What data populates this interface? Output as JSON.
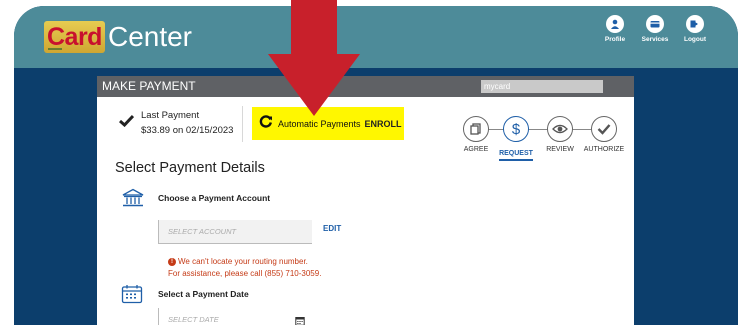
{
  "brand": {
    "logo_card": "Card",
    "logo_center": "Center"
  },
  "nav": [
    {
      "label": "Profile",
      "icon": "profile-icon"
    },
    {
      "label": "Services",
      "icon": "services-icon"
    },
    {
      "label": "Logout",
      "icon": "logout-icon"
    }
  ],
  "panel": {
    "title": "MAKE PAYMENT",
    "account_chip": "mycard"
  },
  "last_payment": {
    "label": "Last Payment",
    "value": "$33.89 on 02/15/2023"
  },
  "auto_payments": {
    "label": "Automatic Payments",
    "action": "ENROLL"
  },
  "steps": [
    {
      "label": "AGREE",
      "icon": "document-icon"
    },
    {
      "label": "REQUEST",
      "icon": "dollar-icon",
      "active": true
    },
    {
      "label": "REVIEW",
      "icon": "eye-icon"
    },
    {
      "label": "AUTHORIZE",
      "icon": "check-icon"
    }
  ],
  "section_title": "Select Payment Details",
  "account_section": {
    "title": "Choose a Payment Account",
    "placeholder": "SELECT ACCOUNT",
    "edit": "EDIT"
  },
  "error": {
    "line1": "We can't locate your routing number.",
    "line2": "For assistance, please call (855) 710-3059."
  },
  "date_section": {
    "title": "Select a Payment Date",
    "placeholder": "SELECT DATE"
  },
  "colors": {
    "header": "#4d8b99",
    "navy": "#0c3e6c",
    "highlight": "#fff700",
    "arrow": "#c8202b",
    "accent": "#1f5fa8",
    "error": "#c53b17"
  }
}
